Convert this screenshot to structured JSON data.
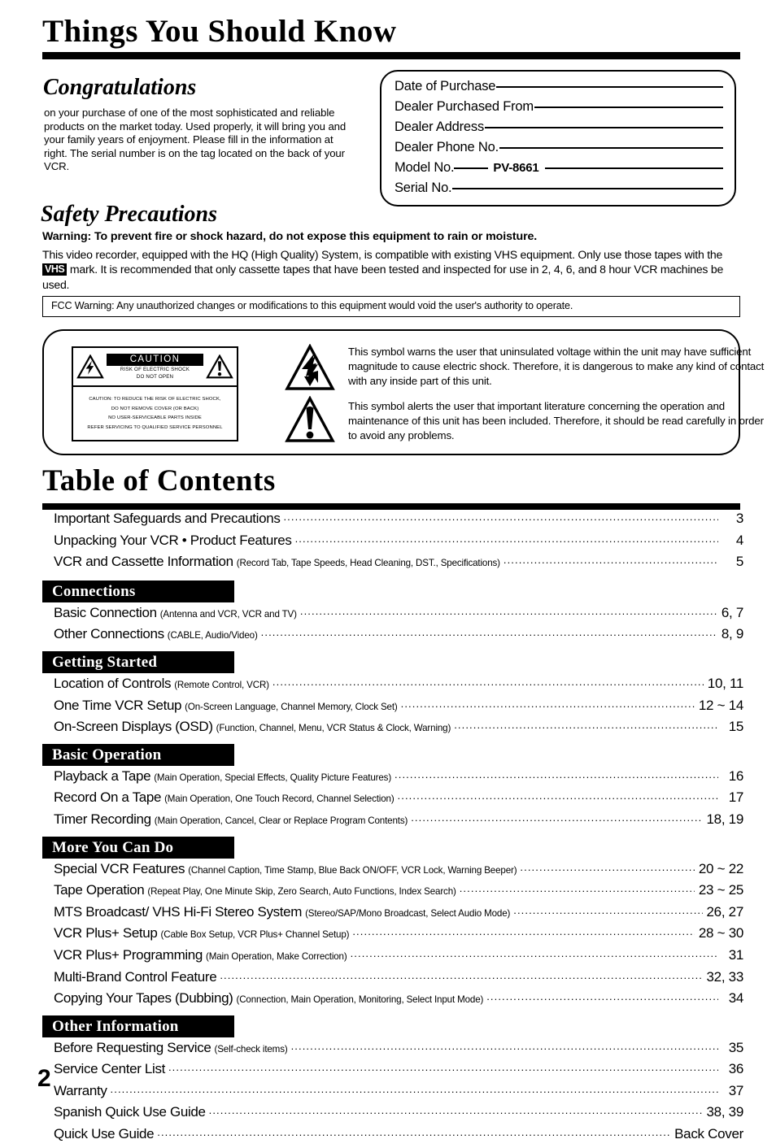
{
  "header": {
    "title": "Things You Should Know"
  },
  "congratulations": {
    "heading": "Congratulations",
    "body": "on your purchase of one of the most sophisticated and reliable products on the market today. Used properly, it will bring you and your family years of enjoyment. Please fill in the information at right. The serial number is on the tag located on the back of your VCR."
  },
  "purchase_record": {
    "rows": [
      {
        "label": "Date of Purchase",
        "value": ""
      },
      {
        "label": "Dealer Purchased From",
        "value": ""
      },
      {
        "label": "Dealer Address",
        "value": ""
      },
      {
        "label": "Dealer Phone No.",
        "value": ""
      },
      {
        "label": "Model No.",
        "value": "PV-8661"
      },
      {
        "label": "Serial No.",
        "value": ""
      }
    ]
  },
  "safety": {
    "heading": "Safety Precautions",
    "warning": "Warning:  To prevent fire or shock hazard, do not expose this equipment to rain or moisture.",
    "body_part1": "This video recorder, equipped with the HQ (High Quality) System, is compatible with existing VHS equipment. Only use those tapes with the ",
    "vhs_mark": "VHS",
    "body_part2": " mark. It is recommended that only cassette tapes that have been tested and inspected for use in 2, 4, 6, and 8 hour VCR machines be used.",
    "fcc_warning": "FCC Warning: Any unauthorized changes or modifications to this equipment would void the user's authority to operate."
  },
  "caution_label": {
    "title": "CAUTION",
    "subtitle_line1": "RISK OF ELECTRIC SHOCK",
    "subtitle_line2": "DO NOT OPEN",
    "body_lines": [
      "CAUTION: TO REDUCE THE RISK OF ELECTRIC SHOCK,",
      "DO NOT REMOVE COVER (OR BACK)",
      "NO USER-SERVICEABLE PARTS INSIDE",
      "REFER SERVICING TO QUALIFIED SERVICE PERSONNEL"
    ]
  },
  "symbols": {
    "bolt_text": "This symbol warns the user that uninsulated voltage within the unit may have sufficient magnitude to cause electric shock. Therefore, it is dangerous to make any kind of contact with any inside part of this unit.",
    "exclamation_text": "This symbol alerts the user that important literature concerning the operation and maintenance of this unit has been included. Therefore, it should be read carefully in order to avoid any problems."
  },
  "toc": {
    "heading": "Table of Contents",
    "entries": [
      {
        "type": "item",
        "title": "Important Safeguards and Precautions",
        "sub": "",
        "page": "3"
      },
      {
        "type": "item",
        "title": "Unpacking Your VCR • Product Features",
        "sub": "",
        "page": "4"
      },
      {
        "type": "item",
        "title": "VCR and Cassette Information",
        "sub": "(Record Tab, Tape Speeds, Head Cleaning, DST., Specifications)",
        "page": "5"
      },
      {
        "type": "section",
        "title": "Connections"
      },
      {
        "type": "item",
        "title": "Basic Connection",
        "sub": "(Antenna and VCR, VCR and TV)",
        "page": "6, 7"
      },
      {
        "type": "item",
        "title": "Other Connections",
        "sub": "(CABLE, Audio/Video)",
        "page": "8, 9"
      },
      {
        "type": "section",
        "title": "Getting Started"
      },
      {
        "type": "item",
        "title": "Location of Controls",
        "sub": "(Remote Control, VCR)",
        "page": "10, 11"
      },
      {
        "type": "item",
        "title": "One Time VCR Setup",
        "sub": "(On-Screen Language, Channel Memory, Clock Set)",
        "page": "12 ~ 14"
      },
      {
        "type": "item",
        "title": "On-Screen Displays (OSD)",
        "sub": "(Function, Channel, Menu, VCR Status & Clock, Warning)",
        "page": "15"
      },
      {
        "type": "section",
        "title": "Basic Operation"
      },
      {
        "type": "item",
        "title": "Playback a Tape",
        "sub": "(Main Operation, Special Effects, Quality Picture Features)",
        "page": "16"
      },
      {
        "type": "item",
        "title": "Record On a Tape",
        "sub": "(Main Operation, One Touch Record, Channel Selection)",
        "page": "17"
      },
      {
        "type": "item",
        "title": "Timer Recording",
        "sub": "(Main Operation, Cancel, Clear or Replace Program Contents)",
        "page": "18, 19"
      },
      {
        "type": "section",
        "title": "More You Can Do"
      },
      {
        "type": "item",
        "title": "Special VCR Features",
        "sub": "(Channel Caption, Time Stamp, Blue Back ON/OFF, VCR Lock, Warning Beeper)",
        "page": "20 ~ 22"
      },
      {
        "type": "item",
        "title": "Tape Operation",
        "sub": "(Repeat Play, One Minute Skip, Zero Search, Auto Functions, Index Search)",
        "page": "23 ~ 25"
      },
      {
        "type": "item",
        "title": "MTS Broadcast/ VHS Hi-Fi Stereo System",
        "sub": "(Stereo/SAP/Mono Broadcast, Select Audio Mode)",
        "page": "26, 27"
      },
      {
        "type": "item",
        "title": "VCR Plus+ Setup",
        "sub": "(Cable Box Setup, VCR Plus+ Channel Setup)",
        "page": "28 ~ 30"
      },
      {
        "type": "item",
        "title": "VCR Plus+ Programming",
        "sub": "(Main Operation, Make Correction)",
        "page": "31"
      },
      {
        "type": "item",
        "title": "Multi-Brand Control Feature",
        "sub": "",
        "page": "32, 33"
      },
      {
        "type": "item",
        "title": "Copying Your Tapes (Dubbing)",
        "sub": "(Connection, Main Operation, Monitoring, Select Input Mode)",
        "page": "34"
      },
      {
        "type": "section",
        "title": "Other Information"
      },
      {
        "type": "item",
        "title": "Before Requesting Service",
        "sub": "(Self-check items)",
        "page": "35"
      },
      {
        "type": "item",
        "title": "Service Center List",
        "sub": "",
        "page": "36"
      },
      {
        "type": "item",
        "title": "Warranty",
        "sub": "",
        "page": "37"
      },
      {
        "type": "item",
        "title": "Spanish Quick Use Guide",
        "sub": "",
        "page": "38, 39"
      },
      {
        "type": "item",
        "title": "Quick Use Guide",
        "sub": "",
        "page": "Back Cover"
      }
    ]
  },
  "footer": {
    "page_number": "2"
  }
}
